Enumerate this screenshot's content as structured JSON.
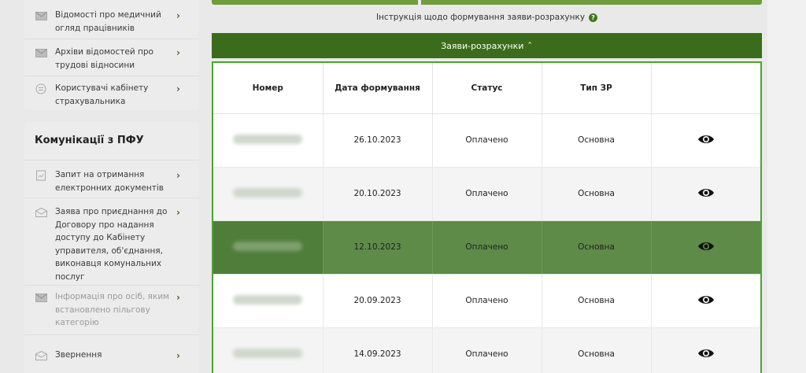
{
  "sidebar": {
    "top_items": [
      {
        "label": "Відомості про медичний огляд працівників",
        "icon": "envelope-icon"
      },
      {
        "label": "Архіви відомостей про трудові відносини",
        "icon": "envelope-icon"
      },
      {
        "label": "Користувачі кабінету страхувальника",
        "icon": "user-list-icon"
      }
    ],
    "communications": {
      "title": "Комунікації з ПФУ",
      "items": [
        {
          "label": "Запит на отримання електронних документів",
          "icon": "document-icon"
        },
        {
          "label": "Заява про приєднання до Договору про надання доступу до Кабінету управителя, об'єднання, виконавця комунальних послуг",
          "icon": "envelope-open-icon"
        },
        {
          "label": "Інформація про осіб, яким встановлено пільгову категорію",
          "icon": "envelope-icon"
        },
        {
          "label": "Звернення",
          "icon": "envelope-open-icon"
        }
      ]
    }
  },
  "main": {
    "instruction": "Інструкція щодо формування заяви-розрахунку",
    "section_title": "Заяви-розрахунки",
    "table": {
      "columns": [
        "Номер",
        "Дата формування",
        "Статус",
        "Тип ЗР",
        ""
      ],
      "rows": [
        {
          "date": "26.10.2023",
          "status": "Оплачено",
          "type": "Основна"
        },
        {
          "date": "20.10.2023",
          "status": "Оплачено",
          "type": "Основна"
        },
        {
          "date": "12.10.2023",
          "status": "Оплачено",
          "type": "Основна"
        },
        {
          "date": "20.09.2023",
          "status": "Оплачено",
          "type": "Основна"
        },
        {
          "date": "14.09.2023",
          "status": "Оплачено",
          "type": "Основна"
        }
      ]
    }
  },
  "colors": {
    "brand_green": "#3b6c1c",
    "accent_green": "#4aa52e",
    "selected_row": "#5e8b48"
  }
}
